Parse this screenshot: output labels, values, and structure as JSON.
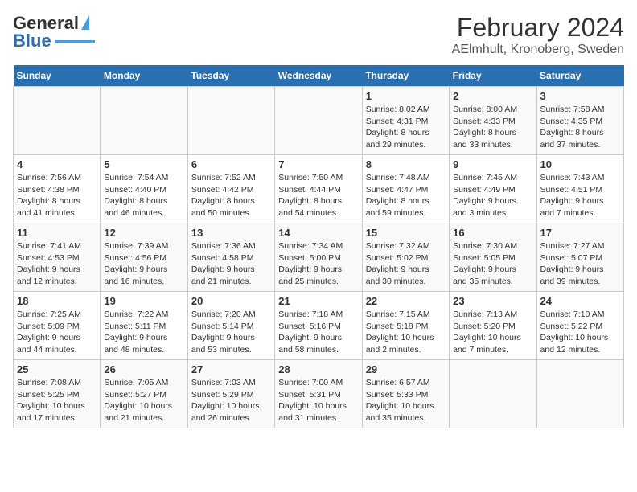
{
  "header": {
    "logo_general": "General",
    "logo_blue": "Blue",
    "month_year": "February 2024",
    "location": "AElmhult, Kronoberg, Sweden"
  },
  "weekdays": [
    "Sunday",
    "Monday",
    "Tuesday",
    "Wednesday",
    "Thursday",
    "Friday",
    "Saturday"
  ],
  "weeks": [
    [
      {
        "day": "",
        "info": ""
      },
      {
        "day": "",
        "info": ""
      },
      {
        "day": "",
        "info": ""
      },
      {
        "day": "",
        "info": ""
      },
      {
        "day": "1",
        "info": "Sunrise: 8:02 AM\nSunset: 4:31 PM\nDaylight: 8 hours\nand 29 minutes."
      },
      {
        "day": "2",
        "info": "Sunrise: 8:00 AM\nSunset: 4:33 PM\nDaylight: 8 hours\nand 33 minutes."
      },
      {
        "day": "3",
        "info": "Sunrise: 7:58 AM\nSunset: 4:35 PM\nDaylight: 8 hours\nand 37 minutes."
      }
    ],
    [
      {
        "day": "4",
        "info": "Sunrise: 7:56 AM\nSunset: 4:38 PM\nDaylight: 8 hours\nand 41 minutes."
      },
      {
        "day": "5",
        "info": "Sunrise: 7:54 AM\nSunset: 4:40 PM\nDaylight: 8 hours\nand 46 minutes."
      },
      {
        "day": "6",
        "info": "Sunrise: 7:52 AM\nSunset: 4:42 PM\nDaylight: 8 hours\nand 50 minutes."
      },
      {
        "day": "7",
        "info": "Sunrise: 7:50 AM\nSunset: 4:44 PM\nDaylight: 8 hours\nand 54 minutes."
      },
      {
        "day": "8",
        "info": "Sunrise: 7:48 AM\nSunset: 4:47 PM\nDaylight: 8 hours\nand 59 minutes."
      },
      {
        "day": "9",
        "info": "Sunrise: 7:45 AM\nSunset: 4:49 PM\nDaylight: 9 hours\nand 3 minutes."
      },
      {
        "day": "10",
        "info": "Sunrise: 7:43 AM\nSunset: 4:51 PM\nDaylight: 9 hours\nand 7 minutes."
      }
    ],
    [
      {
        "day": "11",
        "info": "Sunrise: 7:41 AM\nSunset: 4:53 PM\nDaylight: 9 hours\nand 12 minutes."
      },
      {
        "day": "12",
        "info": "Sunrise: 7:39 AM\nSunset: 4:56 PM\nDaylight: 9 hours\nand 16 minutes."
      },
      {
        "day": "13",
        "info": "Sunrise: 7:36 AM\nSunset: 4:58 PM\nDaylight: 9 hours\nand 21 minutes."
      },
      {
        "day": "14",
        "info": "Sunrise: 7:34 AM\nSunset: 5:00 PM\nDaylight: 9 hours\nand 25 minutes."
      },
      {
        "day": "15",
        "info": "Sunrise: 7:32 AM\nSunset: 5:02 PM\nDaylight: 9 hours\nand 30 minutes."
      },
      {
        "day": "16",
        "info": "Sunrise: 7:30 AM\nSunset: 5:05 PM\nDaylight: 9 hours\nand 35 minutes."
      },
      {
        "day": "17",
        "info": "Sunrise: 7:27 AM\nSunset: 5:07 PM\nDaylight: 9 hours\nand 39 minutes."
      }
    ],
    [
      {
        "day": "18",
        "info": "Sunrise: 7:25 AM\nSunset: 5:09 PM\nDaylight: 9 hours\nand 44 minutes."
      },
      {
        "day": "19",
        "info": "Sunrise: 7:22 AM\nSunset: 5:11 PM\nDaylight: 9 hours\nand 48 minutes."
      },
      {
        "day": "20",
        "info": "Sunrise: 7:20 AM\nSunset: 5:14 PM\nDaylight: 9 hours\nand 53 minutes."
      },
      {
        "day": "21",
        "info": "Sunrise: 7:18 AM\nSunset: 5:16 PM\nDaylight: 9 hours\nand 58 minutes."
      },
      {
        "day": "22",
        "info": "Sunrise: 7:15 AM\nSunset: 5:18 PM\nDaylight: 10 hours\nand 2 minutes."
      },
      {
        "day": "23",
        "info": "Sunrise: 7:13 AM\nSunset: 5:20 PM\nDaylight: 10 hours\nand 7 minutes."
      },
      {
        "day": "24",
        "info": "Sunrise: 7:10 AM\nSunset: 5:22 PM\nDaylight: 10 hours\nand 12 minutes."
      }
    ],
    [
      {
        "day": "25",
        "info": "Sunrise: 7:08 AM\nSunset: 5:25 PM\nDaylight: 10 hours\nand 17 minutes."
      },
      {
        "day": "26",
        "info": "Sunrise: 7:05 AM\nSunset: 5:27 PM\nDaylight: 10 hours\nand 21 minutes."
      },
      {
        "day": "27",
        "info": "Sunrise: 7:03 AM\nSunset: 5:29 PM\nDaylight: 10 hours\nand 26 minutes."
      },
      {
        "day": "28",
        "info": "Sunrise: 7:00 AM\nSunset: 5:31 PM\nDaylight: 10 hours\nand 31 minutes."
      },
      {
        "day": "29",
        "info": "Sunrise: 6:57 AM\nSunset: 5:33 PM\nDaylight: 10 hours\nand 35 minutes."
      },
      {
        "day": "",
        "info": ""
      },
      {
        "day": "",
        "info": ""
      }
    ]
  ]
}
